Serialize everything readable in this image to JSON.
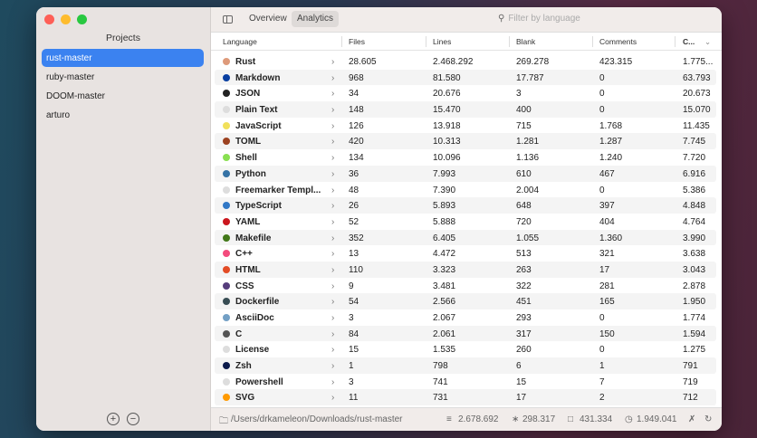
{
  "sidebar": {
    "title": "Projects",
    "projects": [
      "rust-master",
      "ruby-master",
      "DOOM-master",
      "arturo"
    ],
    "add": "+",
    "remove": "−"
  },
  "toolbar": {
    "tabs": [
      "Overview",
      "Analytics"
    ],
    "search_placeholder": "Filter by language"
  },
  "table": {
    "headers": [
      "Language",
      "Files",
      "Lines",
      "Blank",
      "Comments",
      "C..."
    ],
    "rows": [
      [
        "Rust",
        "28.605",
        "2.468.292",
        "269.278",
        "423.315",
        "1.775...",
        "#de9a7a"
      ],
      [
        "Markdown",
        "968",
        "81.580",
        "17.787",
        "0",
        "63.793",
        "#083fa1"
      ],
      [
        "JSON",
        "34",
        "20.676",
        "3",
        "0",
        "20.673",
        "#222222"
      ],
      [
        "Plain Text",
        "148",
        "15.470",
        "400",
        "0",
        "15.070",
        "#dddddd"
      ],
      [
        "JavaScript",
        "126",
        "13.918",
        "715",
        "1.768",
        "11.435",
        "#f1e05a"
      ],
      [
        "TOML",
        "420",
        "10.313",
        "1.281",
        "1.287",
        "7.745",
        "#9c4221"
      ],
      [
        "Shell",
        "134",
        "10.096",
        "1.136",
        "1.240",
        "7.720",
        "#89e051"
      ],
      [
        "Python",
        "36",
        "7.993",
        "610",
        "467",
        "6.916",
        "#3572a5"
      ],
      [
        "Freemarker Templ...",
        "48",
        "7.390",
        "2.004",
        "0",
        "5.386",
        "#dddddd"
      ],
      [
        "TypeScript",
        "26",
        "5.893",
        "648",
        "397",
        "4.848",
        "#3178c6"
      ],
      [
        "YAML",
        "52",
        "5.888",
        "720",
        "404",
        "4.764",
        "#cb171e"
      ],
      [
        "Makefile",
        "352",
        "6.405",
        "1.055",
        "1.360",
        "3.990",
        "#427819"
      ],
      [
        "C++",
        "13",
        "4.472",
        "513",
        "321",
        "3.638",
        "#f34b7d"
      ],
      [
        "HTML",
        "110",
        "3.323",
        "263",
        "17",
        "3.043",
        "#e34c26"
      ],
      [
        "CSS",
        "9",
        "3.481",
        "322",
        "281",
        "2.878",
        "#563d7c"
      ],
      [
        "Dockerfile",
        "54",
        "2.566",
        "451",
        "165",
        "1.950",
        "#384d54"
      ],
      [
        "AsciiDoc",
        "3",
        "2.067",
        "293",
        "0",
        "1.774",
        "#73a0c5"
      ],
      [
        "C",
        "84",
        "2.061",
        "317",
        "150",
        "1.594",
        "#555555"
      ],
      [
        "License",
        "15",
        "1.535",
        "260",
        "0",
        "1.275",
        "#dddddd"
      ],
      [
        "Zsh",
        "1",
        "798",
        "6",
        "1",
        "791",
        "#0b1a4a"
      ],
      [
        "Powershell",
        "3",
        "741",
        "15",
        "7",
        "719",
        "#dddddd"
      ],
      [
        "SVG",
        "11",
        "731",
        "17",
        "2",
        "712",
        "#ff9a00"
      ]
    ]
  },
  "footer": {
    "path": "/Users/drkameleon/Downloads/rust-master",
    "lines": "2.678.692",
    "blank": "298.317",
    "comments": "431.334",
    "code": "1.949.041"
  }
}
